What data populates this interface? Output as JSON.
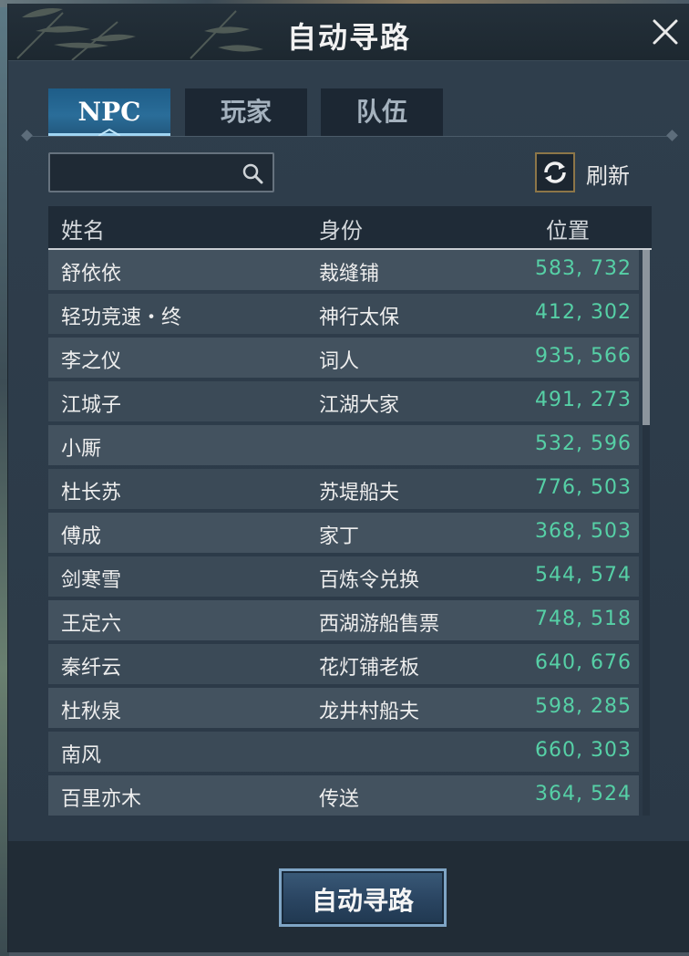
{
  "window": {
    "title": "自动寻路"
  },
  "tabs": [
    {
      "label": "NPC",
      "active": true
    },
    {
      "label": "玩家",
      "active": false
    },
    {
      "label": "队伍",
      "active": false
    }
  ],
  "search": {
    "value": "",
    "placeholder": ""
  },
  "refresh": {
    "label": "刷新"
  },
  "table": {
    "headers": {
      "name": "姓名",
      "role": "身份",
      "position": "位置"
    },
    "rows": [
      {
        "name": "舒依依",
        "role": "裁缝铺",
        "position": "583, 732"
      },
      {
        "name": "轻功竞速・终",
        "role": "神行太保",
        "position": "412, 302"
      },
      {
        "name": "李之仪",
        "role": "词人",
        "position": "935, 566"
      },
      {
        "name": "江城子",
        "role": "江湖大家",
        "position": "491, 273"
      },
      {
        "name": "小厮",
        "role": "",
        "position": "532, 596"
      },
      {
        "name": "杜长苏",
        "role": "苏堤船夫",
        "position": "776, 503"
      },
      {
        "name": "傅成",
        "role": "家丁",
        "position": "368, 503"
      },
      {
        "name": "剑寒雪",
        "role": "百炼令兑换",
        "position": "544, 574"
      },
      {
        "name": "王定六",
        "role": "西湖游船售票",
        "position": "748, 518"
      },
      {
        "name": "秦纤云",
        "role": "花灯铺老板",
        "position": "640, 676"
      },
      {
        "name": "杜秋泉",
        "role": "龙井村船夫",
        "position": "598, 285"
      },
      {
        "name": "南风",
        "role": "",
        "position": "660, 303"
      },
      {
        "name": "百里亦木",
        "role": "传送",
        "position": "364, 524"
      }
    ]
  },
  "footer": {
    "button_label": "自动寻路"
  },
  "colors": {
    "panel_bg": "#2a3744",
    "row_bg": "#43525f",
    "coordinate_text": "#56d0a6",
    "active_tab": "#2a6d99",
    "refresh_border": "#8d7648"
  },
  "icons": [
    "close-icon",
    "search-icon",
    "refresh-icon",
    "bamboo-decoration"
  ]
}
